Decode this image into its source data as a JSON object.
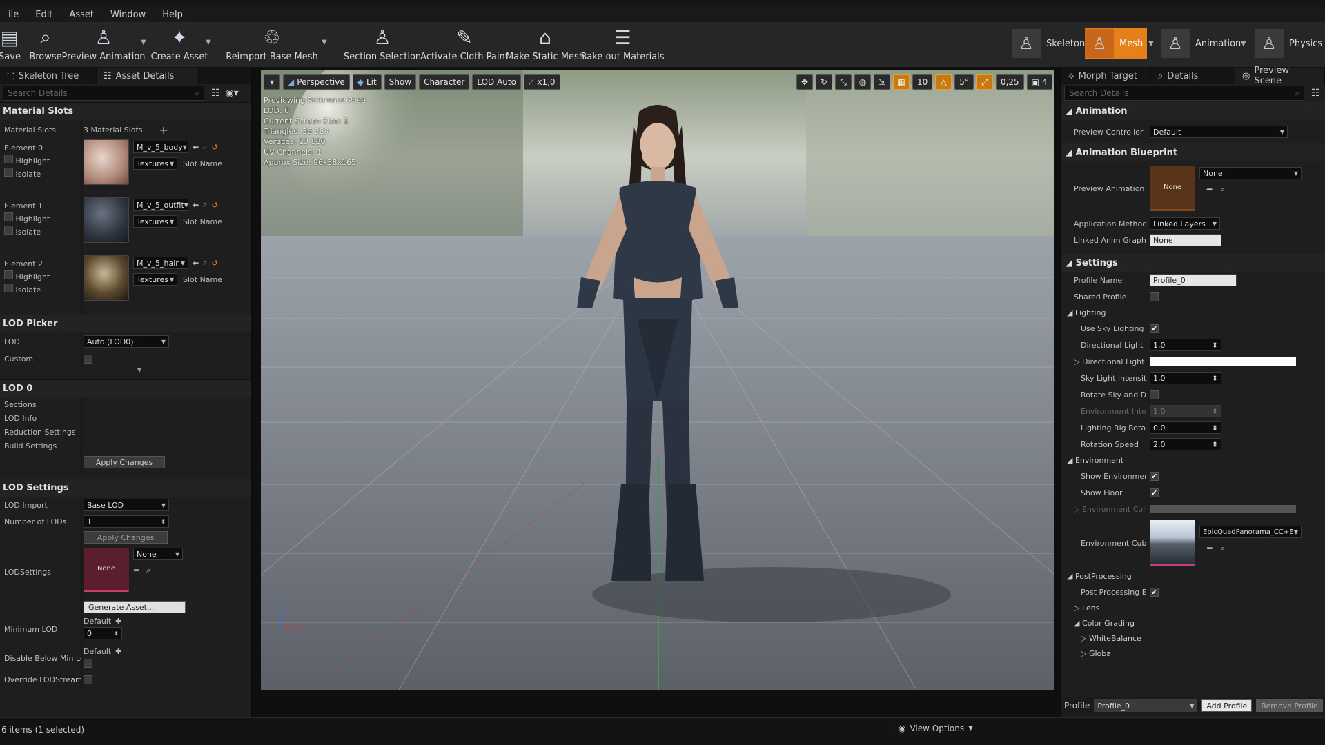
{
  "menu": [
    "ile",
    "Edit",
    "Asset",
    "Window",
    "Help"
  ],
  "toolbar": {
    "save": "Save",
    "browse": "Browse",
    "preview_animation": "Preview Animation",
    "create_asset": "Create Asset",
    "reimport": "Reimport Base Mesh",
    "section_selection": "Section Selection",
    "cloth_paint": "Activate Cloth Paint",
    "static_mesh": "Make Static Mesh",
    "bake_materials": "Bake out Materials"
  },
  "modes": {
    "skeleton": "Skeleton",
    "mesh": "Mesh",
    "animation": "Animation",
    "physics": "Physics"
  },
  "left": {
    "tab_skeleton": "Skeleton Tree",
    "tab_asset": "Asset Details",
    "search_placeholder": "Search Details",
    "material_slots_section": "Material Slots",
    "material_slots_label": "Material Slots",
    "material_slots_count": "3 Material Slots",
    "elements": [
      {
        "label": "Element 0",
        "material": "M_v_5_body"
      },
      {
        "label": "Element 1",
        "material": "M_v_5_outfit"
      },
      {
        "label": "Element 2",
        "material": "M_v_5_hair"
      }
    ],
    "highlight": "Highlight",
    "isolate": "Isolate",
    "textures": "Textures",
    "slot_name": "Slot Name",
    "lod_picker": "LOD Picker",
    "lod_label": "LOD",
    "lod_value": "Auto (LOD0)",
    "custom": "Custom",
    "lod0": "LOD 0",
    "sections": "Sections",
    "lod_info": "LOD Info",
    "reduction": "Reduction Settings",
    "build": "Build Settings",
    "apply": "Apply Changes",
    "lod_settings": "LOD Settings",
    "lod_import": "LOD Import",
    "lod_import_value": "Base LOD",
    "num_lods": "Number of LODs",
    "num_lods_value": "1",
    "lodsettings": "LODSettings",
    "none": "None",
    "generate": "Generate Asset...",
    "min_lod": "Minimum LOD",
    "default": "Default",
    "min_lod_value": "0",
    "disable_below": "Disable Below Min Lo",
    "override": "Override LODStreami"
  },
  "viewport": {
    "perspective": "Perspective",
    "lit": "Lit",
    "show": "Show",
    "character": "Character",
    "lod_auto": "LOD Auto",
    "speed": "x1,0",
    "grid": "10",
    "angle": "5°",
    "scale": "0,25",
    "cam": "4",
    "overlay": [
      "Previewing Reference Pose",
      "LOD: 0",
      "Current Screen Size: 1",
      "Triangles: 36 289",
      "Vertices: 23 830",
      "UV Channels: 1",
      "Approx Size: 96x38x165"
    ]
  },
  "right": {
    "tab_morph": "Morph Target",
    "tab_details": "Details",
    "tab_preview": "Preview Scene",
    "search_placeholder": "Search Details",
    "animation": "Animation",
    "preview_controller": "Preview Controller",
    "preview_controller_value": "Default",
    "anim_bp": "Animation Blueprint",
    "preview_anim_bp": "Preview Animation Bl",
    "none": "None",
    "app_method": "Application Method",
    "app_method_value": "Linked Layers",
    "linked_tag": "Linked Anim Graph Ta",
    "settings": "Settings",
    "profile_name": "Profile Name",
    "profile_value": "Profile_0",
    "shared_profile": "Shared Profile",
    "lighting": "Lighting",
    "use_sky": "Use Sky Lighting",
    "dir_int": "Directional Light Int",
    "dir_int_value": "1,0",
    "dir_col": "Directional Light Co",
    "sky_int": "Sky Light Intensity",
    "sky_int_value": "1,0",
    "rotate_sky": "Rotate Sky and Dire",
    "env_int": "Environment Intensi",
    "env_int_value": "1,0",
    "rig_rot": "Lighting Rig Rotatio",
    "rig_rot_value": "0,0",
    "rot_speed": "Rotation Speed",
    "rot_speed_value": "2,0",
    "environment": "Environment",
    "show_env": "Show Environment",
    "show_floor": "Show Floor",
    "env_color": "Environment Color",
    "env_cube": "Environment Cube M",
    "env_cube_value": "EpicQuadPanorama_CC+E",
    "postproc": "PostProcessing",
    "pp_enabled": "Post Processing En",
    "lens": "Lens",
    "color_grading": "Color Grading",
    "white_balance": "WhiteBalance",
    "global": "Global",
    "profile": "Profile",
    "add_profile": "Add Profile",
    "remove_profile": "Remove Profile"
  },
  "status": {
    "items": "6 items (1 selected)",
    "view_options": "View Options"
  },
  "colors": {
    "accent": "#e5801b",
    "panel": "#1e1e1e",
    "field": "#0d0d0d"
  }
}
